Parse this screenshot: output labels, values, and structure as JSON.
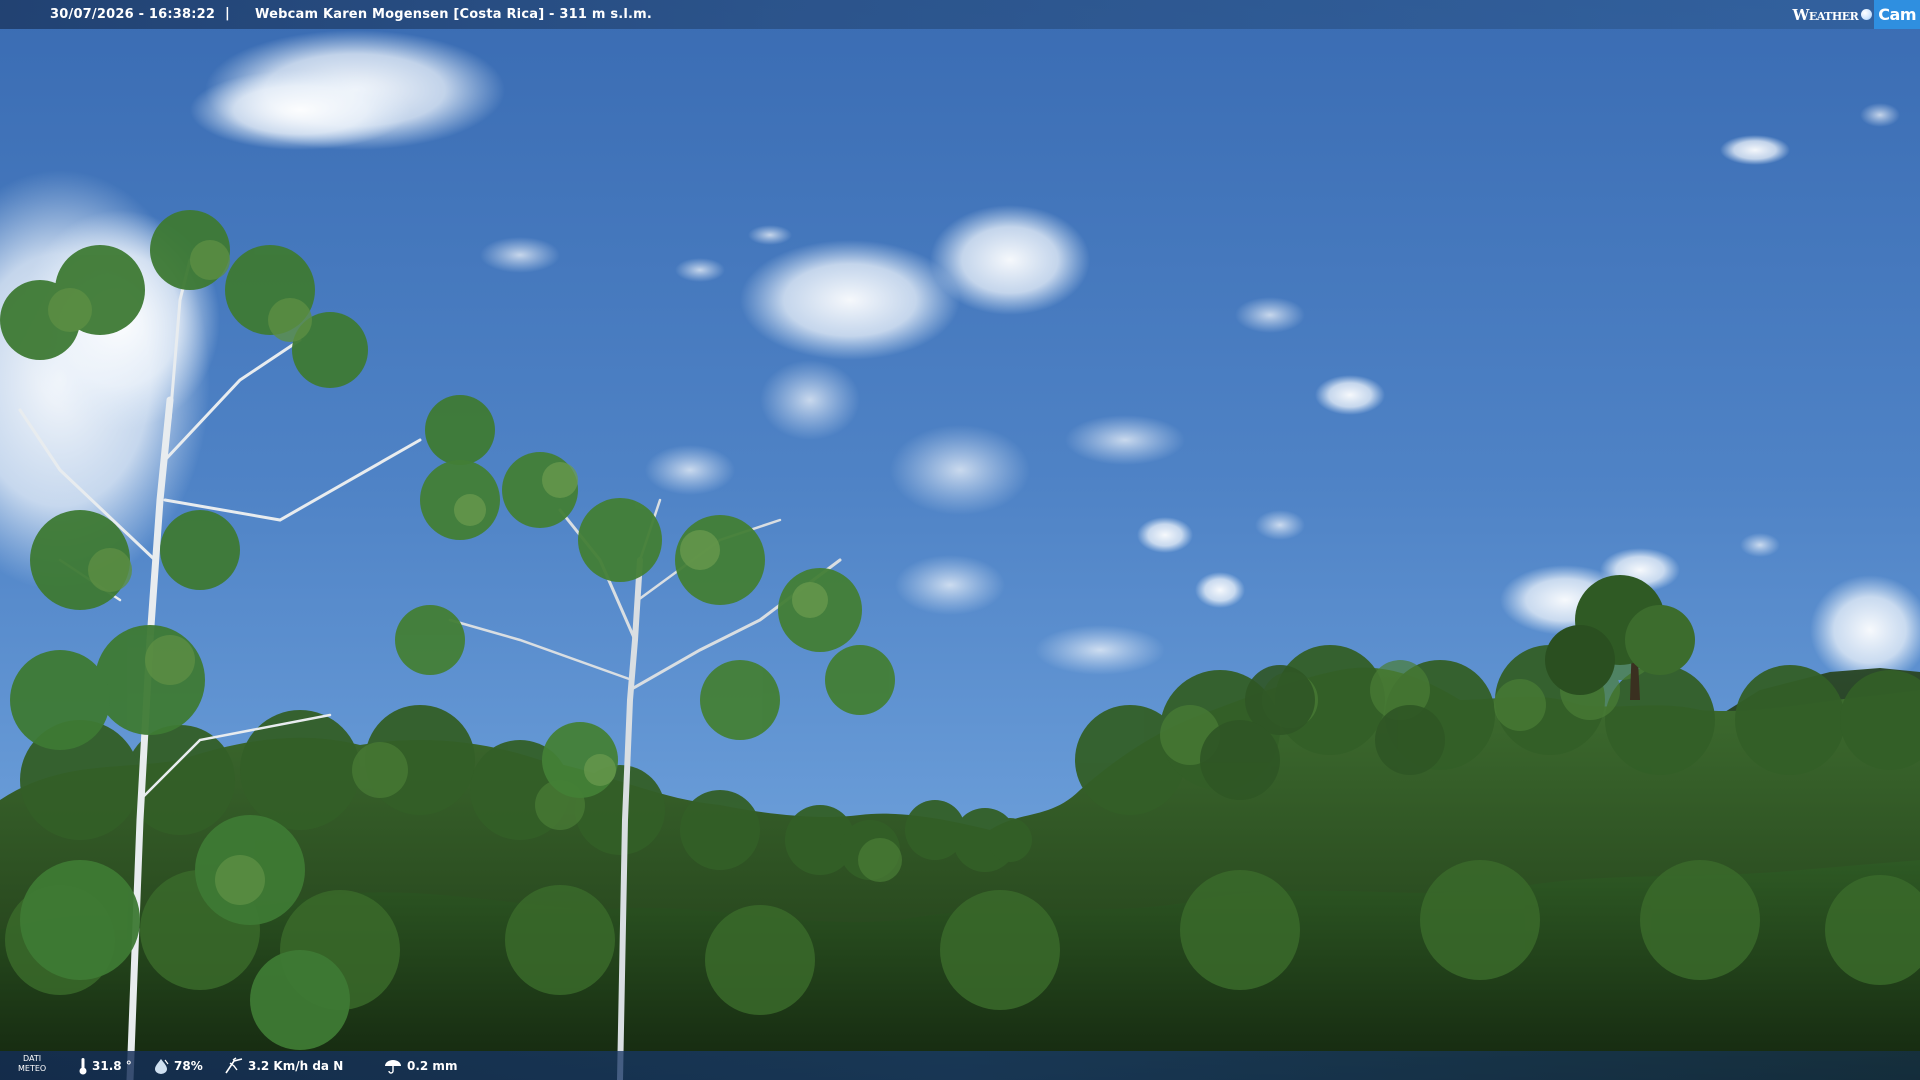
{
  "header": {
    "timestamp": "30/07/2026 - 16:38:22",
    "separator": "|",
    "camera_title": "Webcam Karen Mogensen [Costa Rica] - 311 m s.l.m.",
    "logo_weather": "Weather",
    "logo_cam": "Cam"
  },
  "footer": {
    "label_line1": "DATI",
    "label_line2": "METEO",
    "temperature": "31.8 °",
    "humidity": "78%",
    "wind": "3.2 Km/h da N",
    "rain": "0.2 mm",
    "icons": [
      "thermometer-icon",
      "humidity-icon",
      "wind-icon",
      "rain-icon"
    ]
  },
  "colors": {
    "sky_top": "#3f72b8",
    "sky_bottom": "#6c9fd9",
    "foliage_dark": "#1f3a1a",
    "foliage_light": "#4a7a38",
    "logo_accent": "#2f8fe0"
  }
}
